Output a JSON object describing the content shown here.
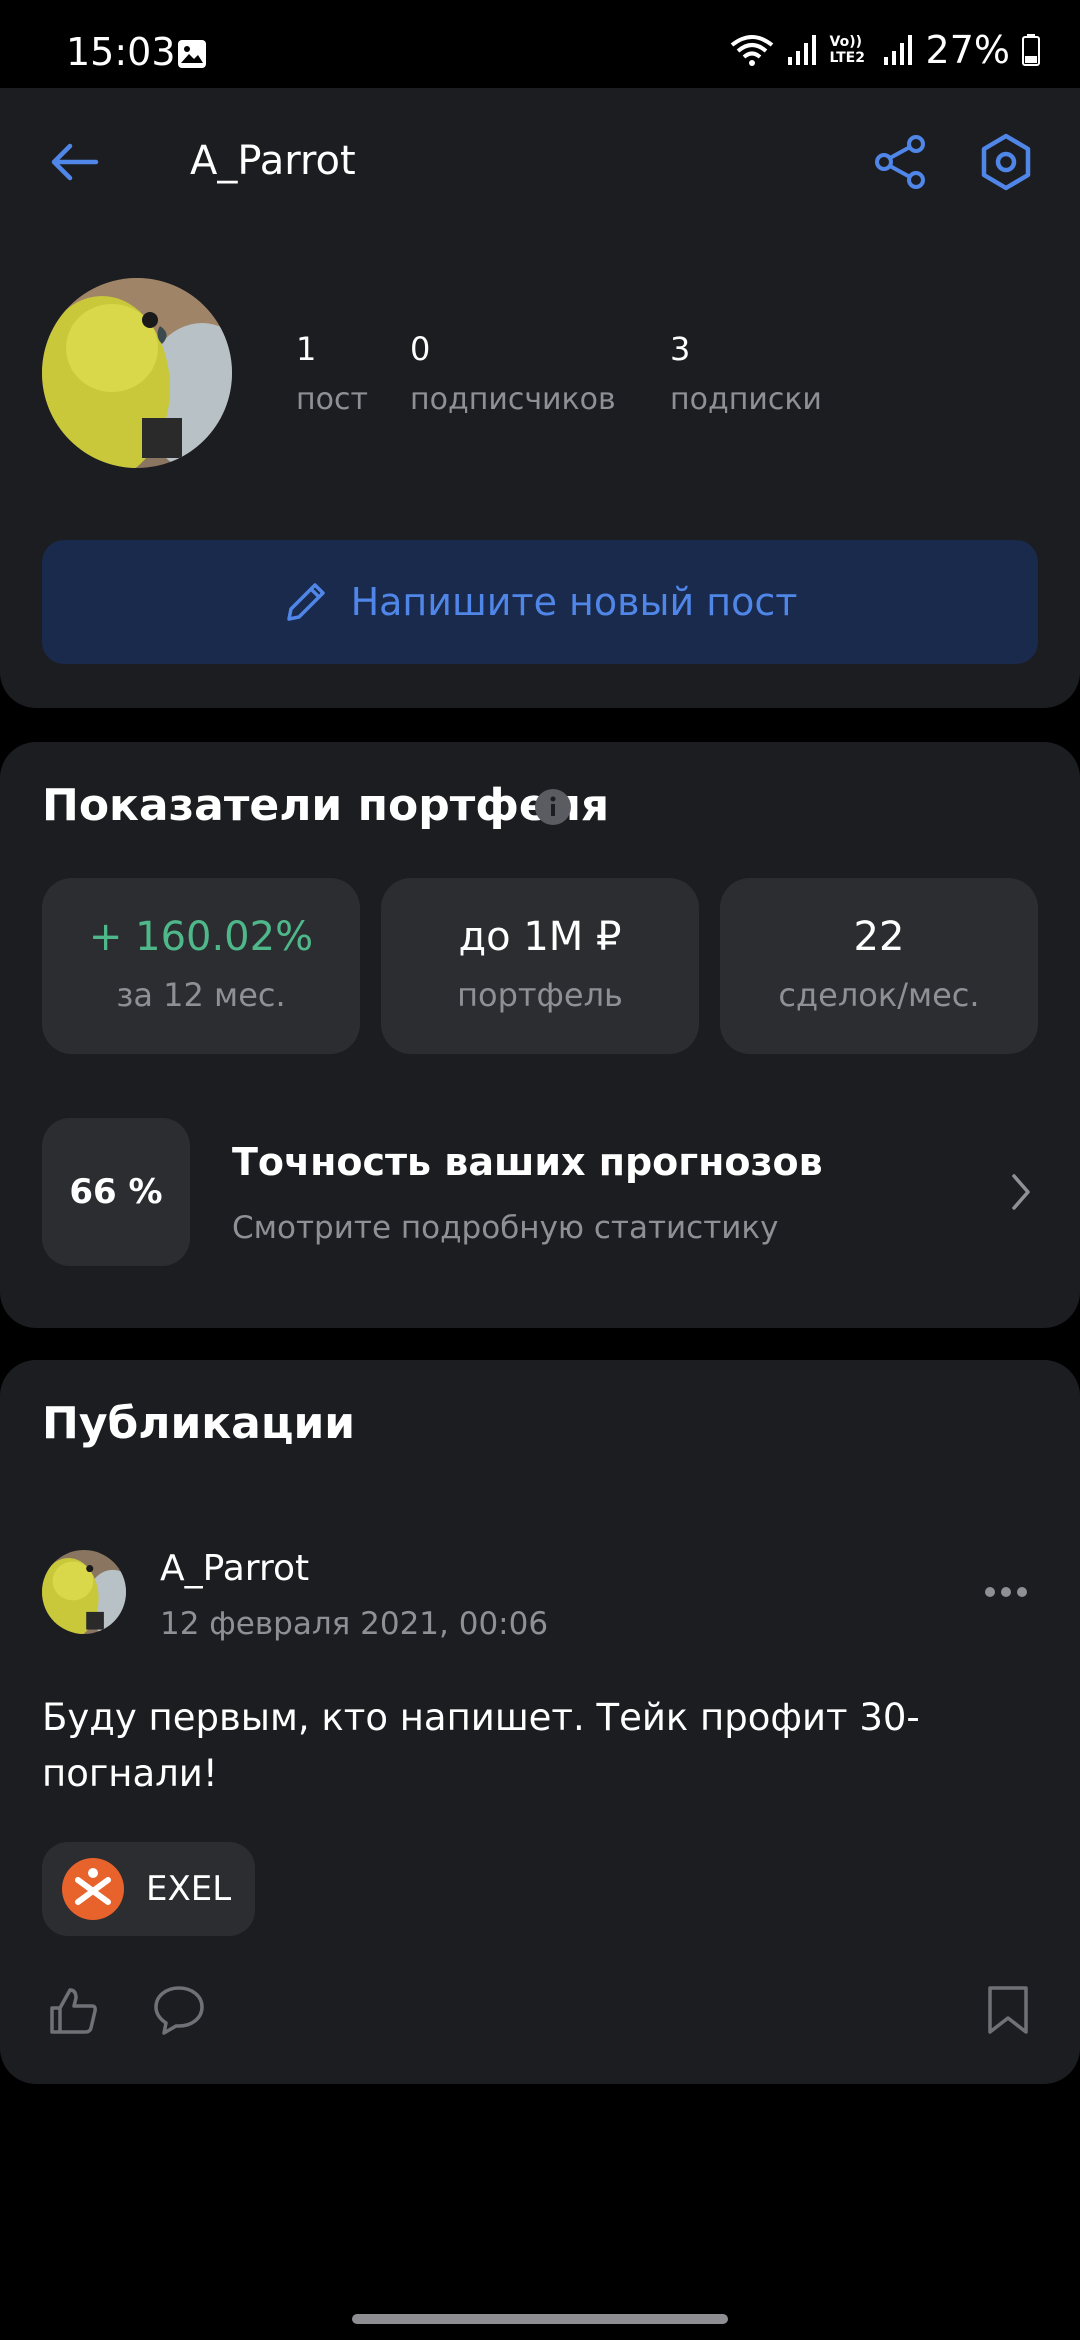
{
  "status_bar": {
    "time": "15:03",
    "network_label": "Vo)) LTE2",
    "battery": "27%"
  },
  "header": {
    "title": "A_Parrot",
    "icons": {
      "back": "arrow-left-icon",
      "share": "share-icon",
      "settings": "settings-hexagon-icon"
    }
  },
  "profile": {
    "stats": [
      {
        "value": "1",
        "label": "пост"
      },
      {
        "value": "0",
        "label": "подписчиков"
      },
      {
        "value": "3",
        "label": "подписки"
      }
    ],
    "new_post_label": "Напишите новый пост"
  },
  "metrics": {
    "title": "Показатели портфеля",
    "tiles": [
      {
        "value": "+ 160.02%",
        "label": "за 12 мес."
      },
      {
        "value": "до 1M ₽",
        "label": "портфель"
      },
      {
        "value": "22",
        "label": "сделок/мес."
      }
    ],
    "accuracy": {
      "value": "66 %",
      "title": "Точность ваших прогнозов",
      "subtitle": "Смотрите подробную статистику"
    }
  },
  "publications": {
    "title": "Публикации",
    "post": {
      "author": "A_Parrot",
      "date": "12 февраля 2021, 00:06",
      "text": "Буду первым, кто напишет. Тейк профит 30- погнали!",
      "ticker": "EXEL"
    }
  },
  "colors": {
    "accent": "#4f86e8",
    "positive": "#4fb88a",
    "card_bg": "#1c1d21",
    "tile_bg": "#2c2d31",
    "ticker_logo": "#e8622b"
  }
}
